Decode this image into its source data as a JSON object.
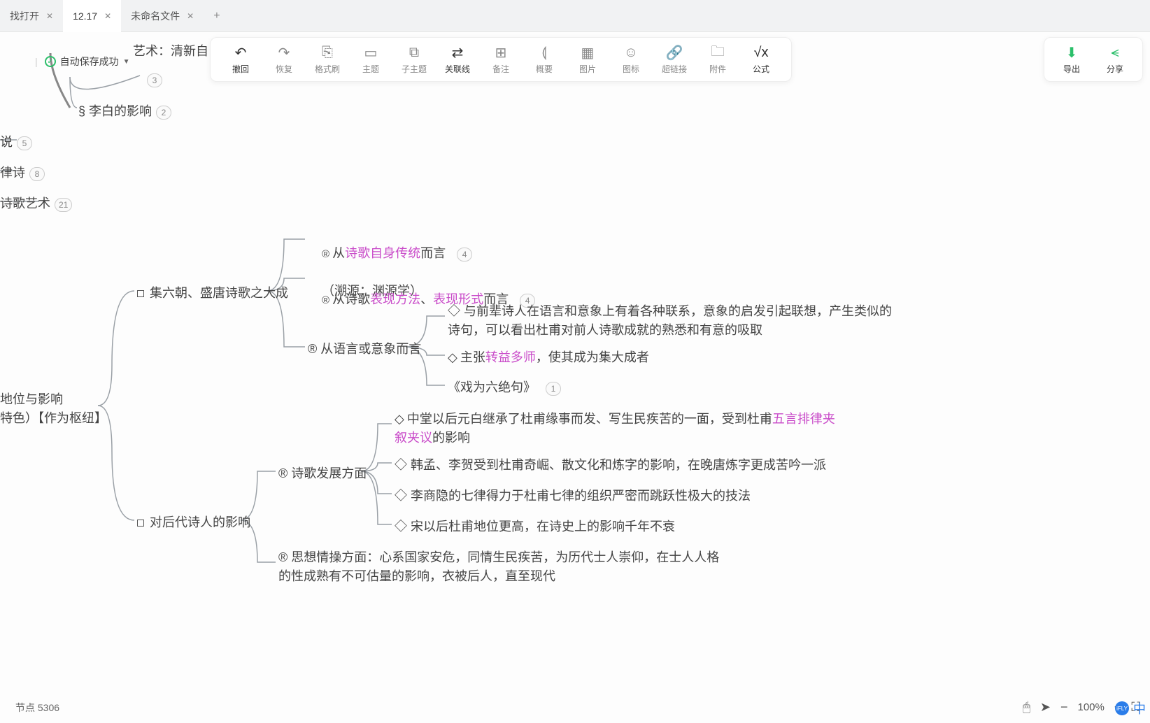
{
  "tabs": [
    {
      "label": "找打开",
      "active": false
    },
    {
      "label": "12.17",
      "active": true
    },
    {
      "label": "未命名文件",
      "active": false
    }
  ],
  "autosave": {
    "label": "自动保存成功"
  },
  "toolbar": {
    "items": [
      {
        "id": "undo",
        "icon": "↶",
        "label": "撤回",
        "color": "#333"
      },
      {
        "id": "redo",
        "icon": "↷",
        "label": "恢复"
      },
      {
        "id": "format",
        "icon": "⎘",
        "label": "格式刷"
      },
      {
        "id": "topic",
        "icon": "▭",
        "label": "主题"
      },
      {
        "id": "subtopic",
        "icon": "⧉",
        "label": "子主题"
      },
      {
        "id": "link",
        "icon": "⇄",
        "label": "关联线",
        "color": "#333"
      },
      {
        "id": "note",
        "icon": "⊞",
        "label": "备注"
      },
      {
        "id": "summary",
        "icon": "⟬",
        "label": "概要"
      },
      {
        "id": "image",
        "icon": "▦",
        "label": "图片"
      },
      {
        "id": "emoji",
        "icon": "☺",
        "label": "图标"
      },
      {
        "id": "hyperlink",
        "icon": "🔗",
        "label": "超链接"
      },
      {
        "id": "attach",
        "icon": "🗀",
        "label": "附件"
      },
      {
        "id": "formula",
        "icon": "√x",
        "label": "公式",
        "color": "#333"
      }
    ],
    "side": [
      {
        "id": "export",
        "icon": "⬇",
        "label": "导出"
      },
      {
        "id": "share",
        "icon": "⪪",
        "label": "分享"
      }
    ]
  },
  "nodes": {
    "art_fragment": "艺术：清新自",
    "n3_badge": "3",
    "libai": {
      "text": "§ 李白的影响",
      "badge": "2"
    },
    "shuo": {
      "text": "说",
      "badge": "5"
    },
    "lvshi": {
      "text": "律诗",
      "badge": "8"
    },
    "shigeart": {
      "text": "诗歌艺术",
      "badge": "21"
    },
    "root": "地位与影响\n特色）【作为枢纽】",
    "jiliuchao": "集六朝、盛唐诗歌之大成",
    "houdai": "对后代诗人的影响",
    "r1_pre": "® 从",
    "r1_hl": "诗歌自身传统",
    "r1_post": "而言",
    "r1_line2": "（溯源：渊源学）",
    "r1_badge": "4",
    "r2_pre": "® 从诗歌",
    "r2_hl1": "表现方法",
    "r2_sep": "、",
    "r2_hl2": "表现形式",
    "r2_post": "而言",
    "r2_badge": "4",
    "r3": "® 从语言或意象而言",
    "r3a": "◇ 与前辈诗人在语言和意象上有着各种联系，意象的启发引起联想，产生类似的\n诗句，可以看出杜甫对前人诗歌成就的熟悉和有意的吸取",
    "r3b_pre": "◇ 主张",
    "r3b_hl": "转益多师",
    "r3b_post": "，使其成为集大成者",
    "r3c": "《戏为六绝句》",
    "r3c_badge": "1",
    "h1": "® 诗歌发展方面",
    "h1a_pre": "◇ 中堂以后元白继承了杜甫缘事而发、写生民疾苦的一面，受到杜甫",
    "h1a_hl": "五言排律夹\n叙夹议",
    "h1a_post": "的影响",
    "h1b": "◇ 韩孟、李贺受到杜甫奇崛、散文化和炼字的影响，在晚唐炼字更成苦吟一派",
    "h1c": "◇ 李商隐的七律得力于杜甫七律的组织严密而跳跃性极大的技法",
    "h1d": "◇ 宋以后杜甫地位更高，在诗史上的影响千年不衰",
    "h2": "® 思想情操方面：心系国家安危，同情生民疾苦，为历代士人崇仰，在士人人格\n的性成熟有不可估量的影响，衣被后人，直至现代"
  },
  "footer": {
    "nodes_label": "节点 5306",
    "zoom": "100%"
  },
  "ime": {
    "brand": "iFLY",
    "mode": "中"
  }
}
